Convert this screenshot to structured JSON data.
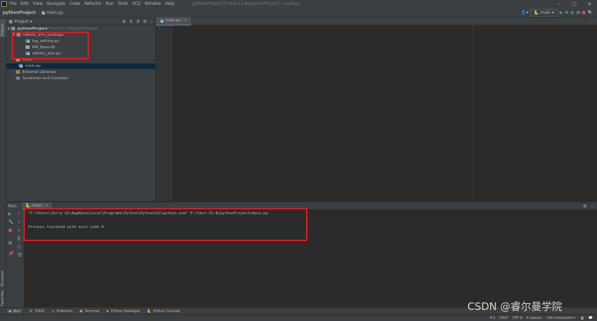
{
  "app": {
    "menu": [
      "File",
      "Edit",
      "View",
      "Navigate",
      "Code",
      "Refactor",
      "Run",
      "Tools",
      "VCS",
      "Window",
      "Help"
    ],
    "window_title": "pythonProject [F:\\test-11-8\\pythonProject] - main.py"
  },
  "navbar": {
    "project": "pythonProject",
    "file": "main.py",
    "run_config": "main"
  },
  "project_panel": {
    "title": "Project",
    "tree": [
      {
        "label": "pythonProject",
        "extra": "F:\\test-11-8\\pythonProject"
      },
      {
        "label": "robotic_arm_package"
      },
      {
        "label": "log_setting.py"
      },
      {
        "label": "RM_Base.dll"
      },
      {
        "label": "robotic_arm.py"
      },
      {
        "label": "venv"
      },
      {
        "label": "main.py"
      },
      {
        "label": "External Libraries"
      },
      {
        "label": "Scratches and Consoles"
      }
    ]
  },
  "editor": {
    "tab_label": "main.py",
    "line_number": "1"
  },
  "run_panel": {
    "label": "Run:",
    "config": "main",
    "command": "\"C:\\Users\\Jerry Q1\\AppData\\Local\\Programs\\Python\\Python312\\python.exe\" F:/test-11-8/pythonProject/main.py",
    "finished": "Process finished with exit code 0"
  },
  "left_tabs": {
    "project": "Project",
    "structure": "Structure",
    "favorites": "Favorites"
  },
  "bottom_tabs": [
    "Run",
    "TODO",
    "Problems",
    "Terminal",
    "Python Packages",
    "Python Console"
  ],
  "status": {
    "pos": "4:1",
    "crlf": "CRLF",
    "encoding": "UTF-8",
    "indent": "4 spaces",
    "interpreter": "<No interpreter>"
  },
  "watermark": "CSDN @睿尔曼学院",
  "colors": {
    "highlight": "#e01b24",
    "accent": "#4a88c7",
    "selection": "#0d293e"
  }
}
